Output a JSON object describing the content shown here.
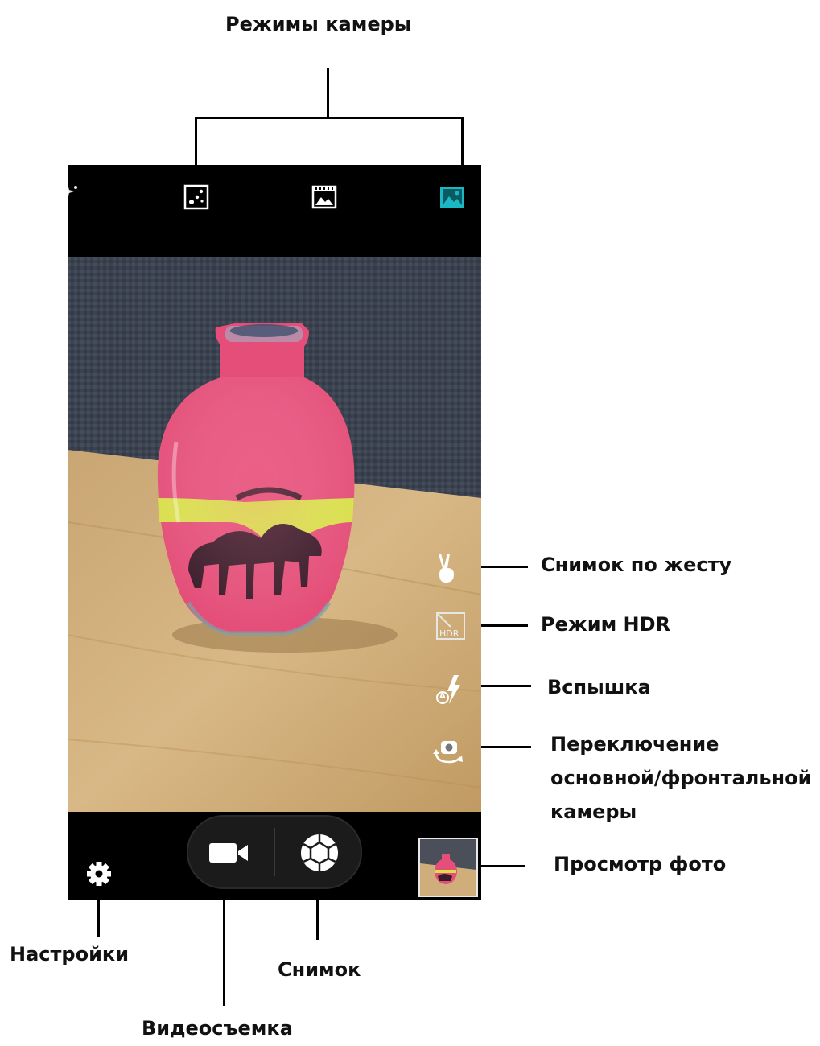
{
  "annotations": {
    "camera_modes": "Режимы камеры",
    "gesture_shot": "Снимок по жесту",
    "hdr_mode": "Режим HDR",
    "flash": "Вспышка",
    "switch_camera_line1": "Переключение",
    "switch_camera_line2": "основной/фронтальной",
    "switch_camera_line3": "камеры",
    "photo_view": "Просмотр фото",
    "settings": "Настройки",
    "shutter": "Снимок",
    "video": "Видеосъемка"
  },
  "screen": {
    "hdr_icon_text": "HDR",
    "flash_auto_text": "A",
    "active_mode_color": "#1bb7c4"
  },
  "icons": {
    "top_bar": [
      "sparkle-icon",
      "dots-mode-icon",
      "panorama-film-icon",
      "landscape-photo-icon"
    ],
    "right_bar": [
      "gesture-icon",
      "hdr-icon",
      "flash-auto-icon",
      "switch-camera-icon"
    ],
    "bottom_bar": [
      "gear-icon",
      "video-camera-icon",
      "shutter-icon",
      "gallery-thumbnail"
    ]
  }
}
